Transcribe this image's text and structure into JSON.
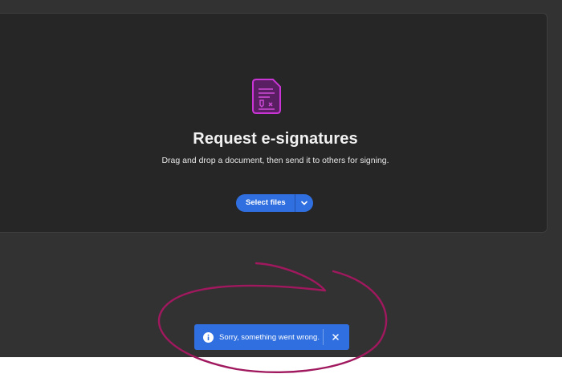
{
  "main": {
    "title": "Request e-signatures",
    "subtitle": "Drag and drop a document, then send it to others for signing.",
    "select_files_label": "Select files",
    "icon": "signature-document-icon"
  },
  "toast": {
    "message": "Sorry, something went wrong.",
    "icon": "info-icon",
    "close_icon": "close-icon"
  },
  "colors": {
    "accent": "#2f6fe0",
    "icon_purple": "#c026c9",
    "annotation": "#a0185e"
  }
}
